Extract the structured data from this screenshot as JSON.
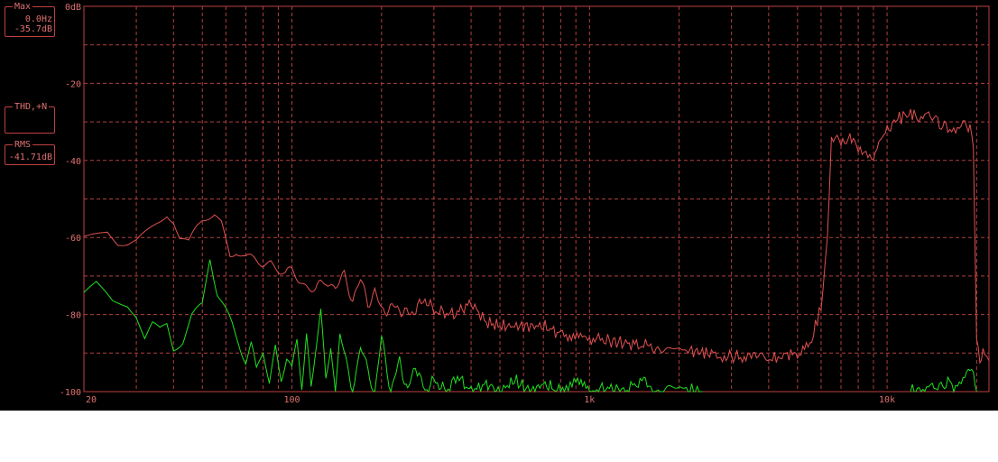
{
  "readouts": {
    "max": {
      "caption": "Max",
      "freq": "0.0Hz",
      "level": "-35.7dB"
    },
    "thd": {
      "caption": "THD,+N"
    },
    "rms": {
      "caption": "RMS",
      "level": "-41.71dB"
    }
  },
  "colors": {
    "background": "#000000",
    "grid": "#b04040",
    "axis": "#c04040",
    "text": "#e07070",
    "series_red": "#e05050",
    "series_green": "#20e020"
  },
  "chart_data": {
    "type": "line",
    "x_scale": "log",
    "xlim": [
      20,
      22000
    ],
    "ylim": [
      -100,
      0
    ],
    "grid": true,
    "x_ticks": [
      {
        "v": 20,
        "label": "20"
      },
      {
        "v": 100,
        "label": "100"
      },
      {
        "v": 1000,
        "label": "1k"
      },
      {
        "v": 10000,
        "label": "10k"
      }
    ],
    "y_ticks": [
      {
        "v": 0,
        "label": "0dB"
      },
      {
        "v": -20,
        "label": "-20"
      },
      {
        "v": -40,
        "label": "-40"
      },
      {
        "v": -60,
        "label": "-60"
      },
      {
        "v": -80,
        "label": "-80"
      },
      {
        "v": -100,
        "label": "-100"
      }
    ],
    "series": [
      {
        "color": "#e05050",
        "x": [
          20,
          22,
          24,
          26,
          28,
          30,
          33,
          36,
          38,
          40,
          42,
          45,
          48,
          50,
          55,
          58,
          60,
          62,
          65,
          70,
          75,
          80,
          85,
          90,
          95,
          100,
          110,
          120,
          130,
          140,
          150,
          160,
          170,
          180,
          190,
          200,
          220,
          250,
          280,
          300,
          350,
          400,
          450,
          500,
          600,
          700,
          800,
          1000,
          1200,
          1500,
          2000,
          2500,
          3000,
          3500,
          4000,
          4500,
          5000,
          5500,
          6000,
          6300,
          6500,
          7000,
          7500,
          8000,
          8500,
          9000,
          9500,
          10000,
          11000,
          12000,
          13000,
          14000,
          15000,
          16000,
          17000,
          18000,
          19000,
          19500,
          20000,
          20500,
          21000,
          22000
        ],
        "y": [
          -61,
          -60,
          -59,
          -62,
          -62,
          -61,
          -58,
          -55,
          -53,
          -55,
          -60,
          -62,
          -58,
          -56,
          -54,
          -56,
          -60,
          -64,
          -63,
          -66,
          -66,
          -67,
          -66,
          -68,
          -70,
          -69,
          -72,
          -74,
          -71,
          -73,
          -70,
          -76,
          -71,
          -77,
          -74,
          -79,
          -78,
          -80,
          -76,
          -79,
          -80,
          -77,
          -82,
          -83,
          -83,
          -83,
          -85,
          -86,
          -87,
          -88,
          -89,
          -90,
          -91,
          -91,
          -92,
          -90,
          -91,
          -88,
          -78,
          -60,
          -35,
          -35,
          -34,
          -37,
          -38,
          -40,
          -34,
          -32,
          -29,
          -28,
          -29,
          -28,
          -30,
          -31,
          -32,
          -30,
          -32,
          -35,
          -88,
          -91,
          -90,
          -92
        ]
      },
      {
        "color": "#20e020",
        "x": [
          20,
          22,
          25,
          28,
          30,
          32,
          34,
          36,
          38,
          40,
          43,
          46,
          50,
          53,
          56,
          60,
          63,
          66,
          70,
          73,
          76,
          80,
          84,
          88,
          92,
          96,
          100,
          104,
          108,
          112,
          116,
          120,
          125,
          130,
          135,
          140,
          145,
          150,
          160,
          170,
          180,
          190,
          200,
          215,
          230,
          245,
          260,
          280,
          300,
          330,
          360,
          400,
          450,
          500,
          560,
          630,
          700,
          800,
          900,
          1000,
          1150,
          1300,
          1500,
          1700,
          2000,
          2400
        ],
        "y": [
          -74,
          -72,
          -77,
          -78,
          -81,
          -87,
          -83,
          -84,
          -82,
          -88,
          -86,
          -80,
          -78,
          -66,
          -75,
          -79,
          -82,
          -86,
          -92,
          -88,
          -95,
          -90,
          -98,
          -88,
          -96,
          -91,
          -95,
          -87,
          -99,
          -85,
          -98,
          -89,
          -80,
          -97,
          -88,
          -100,
          -84,
          -91,
          -100,
          -88,
          -95,
          -100,
          -86,
          -100,
          -92,
          -100,
          -93,
          -100,
          -97,
          -100,
          -96,
          -100,
          -98,
          -100,
          -97,
          -100,
          -98,
          -100,
          -96,
          -100,
          -99,
          -100,
          -97,
          -100,
          -99,
          -100
        ]
      },
      {
        "color": "#20e020",
        "x": [
          12000,
          13000,
          14000,
          15000,
          16000,
          17000,
          18000,
          19000,
          19500,
          20000
        ],
        "y": [
          -100,
          -99,
          -98,
          -99,
          -98,
          -100,
          -97,
          -94,
          -96,
          -100
        ]
      }
    ]
  }
}
